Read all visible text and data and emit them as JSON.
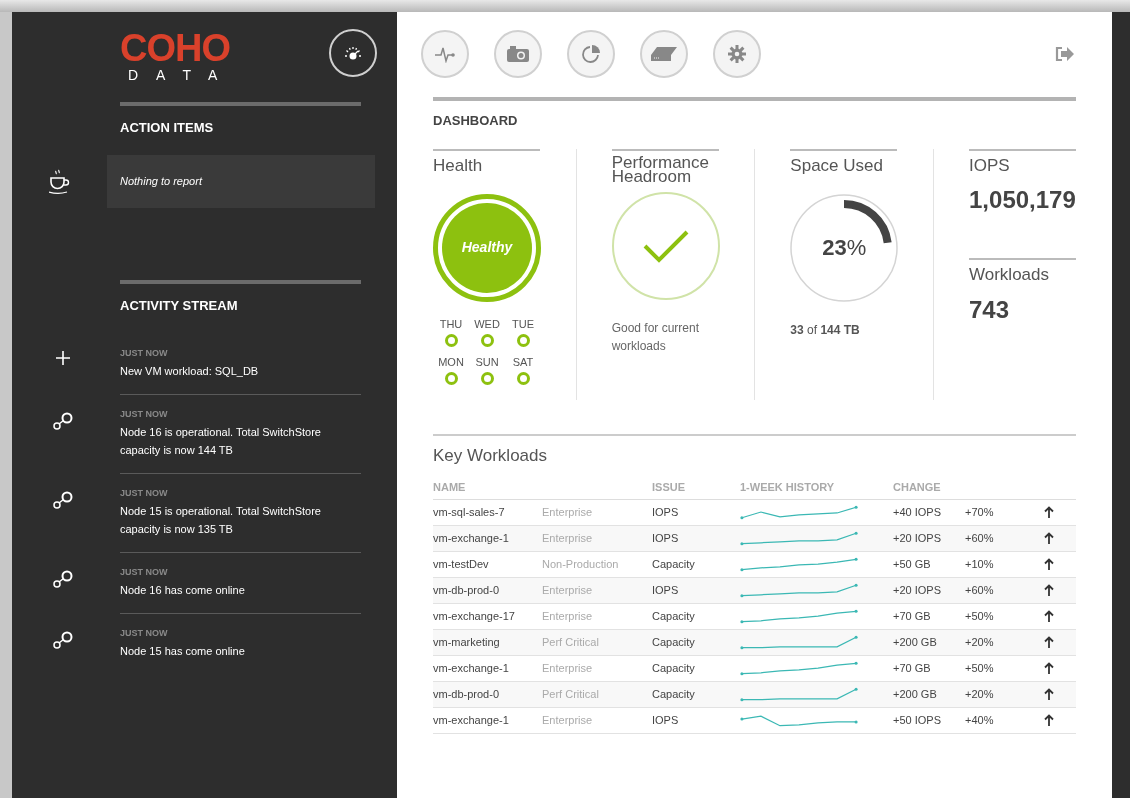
{
  "logo": {
    "brand": "COHO",
    "sub": "DATA"
  },
  "sidebar": {
    "action_items": {
      "title": "ACTION ITEMS",
      "message": "Nothing to report"
    },
    "activity_stream": {
      "title": "ACTIVITY STREAM",
      "items": [
        {
          "kind": "add",
          "time": "JUST NOW",
          "text": "New VM workload: SQL_DB"
        },
        {
          "kind": "node",
          "time": "JUST NOW",
          "text": "Node 16 is operational. Total SwitchStore capacity is now 144 TB"
        },
        {
          "kind": "node",
          "time": "JUST NOW",
          "text": "Node 15 is operational. Total SwitchStore capacity is now 135 TB"
        },
        {
          "kind": "node",
          "time": "JUST NOW",
          "text": "Node 16 has come online"
        },
        {
          "kind": "node",
          "time": "JUST NOW",
          "text": "Node 15 has come online"
        }
      ]
    }
  },
  "dashboard": {
    "title": "DASHBOARD",
    "health": {
      "title": "Health",
      "status": "Healthy",
      "days": [
        {
          "label": "THU",
          "color": "#8dc10f"
        },
        {
          "label": "WED",
          "color": "#8dc10f"
        },
        {
          "label": "TUE",
          "color": "#8dc10f"
        },
        {
          "label": "MON",
          "color": "#8dc10f"
        },
        {
          "label": "SUN",
          "color": "#8dc10f"
        },
        {
          "label": "SAT",
          "color": "#8dc10f"
        }
      ]
    },
    "performance": {
      "title": "Performance Headroom",
      "caption": "Good for current workloads"
    },
    "space": {
      "title": "Space Used",
      "level": 0.23,
      "percent": "23",
      "percent_sign": "%",
      "detail": "**33** of **144 TB**"
    },
    "iops": {
      "title": "IOPS",
      "value": "1,050,179"
    },
    "workloads": {
      "title": "Workloads",
      "value": "743"
    }
  },
  "key_workloads": {
    "title": "Key Workloads",
    "columns": [
      "NAME",
      "ISSUE",
      "1-WEEK HISTORY",
      "CHANGE"
    ],
    "rows": [
      {
        "name": "vm-sql-sales-7",
        "tier": "Enterprise",
        "issue": "IOPS",
        "change": "+40 IOPS",
        "percent": "+70%"
      },
      {
        "name": "vm-exchange-1",
        "tier": "Enterprise",
        "issue": "IOPS",
        "change": "+20 IOPS",
        "percent": "+60%"
      },
      {
        "name": "vm-testDev",
        "tier": "Non-Production",
        "issue": "Capacity",
        "change": "+50 GB",
        "percent": "+10%"
      },
      {
        "name": "vm-db-prod-0",
        "tier": "Enterprise",
        "issue": "IOPS",
        "change": "+20 IOPS",
        "percent": "+60%"
      },
      {
        "name": "vm-exchange-17",
        "tier": "Enterprise",
        "issue": "Capacity",
        "change": "+70 GB",
        "percent": "+50%"
      },
      {
        "name": "vm-marketing",
        "tier": "Perf Critical",
        "issue": "Capacity",
        "change": "+200 GB",
        "percent": "+20%"
      },
      {
        "name": "vm-exchange-1",
        "tier": "Enterprise",
        "issue": "Capacity",
        "change": "+70 GB",
        "percent": "+50%"
      },
      {
        "name": "vm-db-prod-0",
        "tier": "Perf Critical",
        "issue": "Capacity",
        "change": "+200 GB",
        "percent": "+20%"
      },
      {
        "name": "vm-exchange-1",
        "tier": "Enterprise",
        "issue": "IOPS",
        "change": "+50 IOPS",
        "percent": "+40%"
      }
    ]
  }
}
